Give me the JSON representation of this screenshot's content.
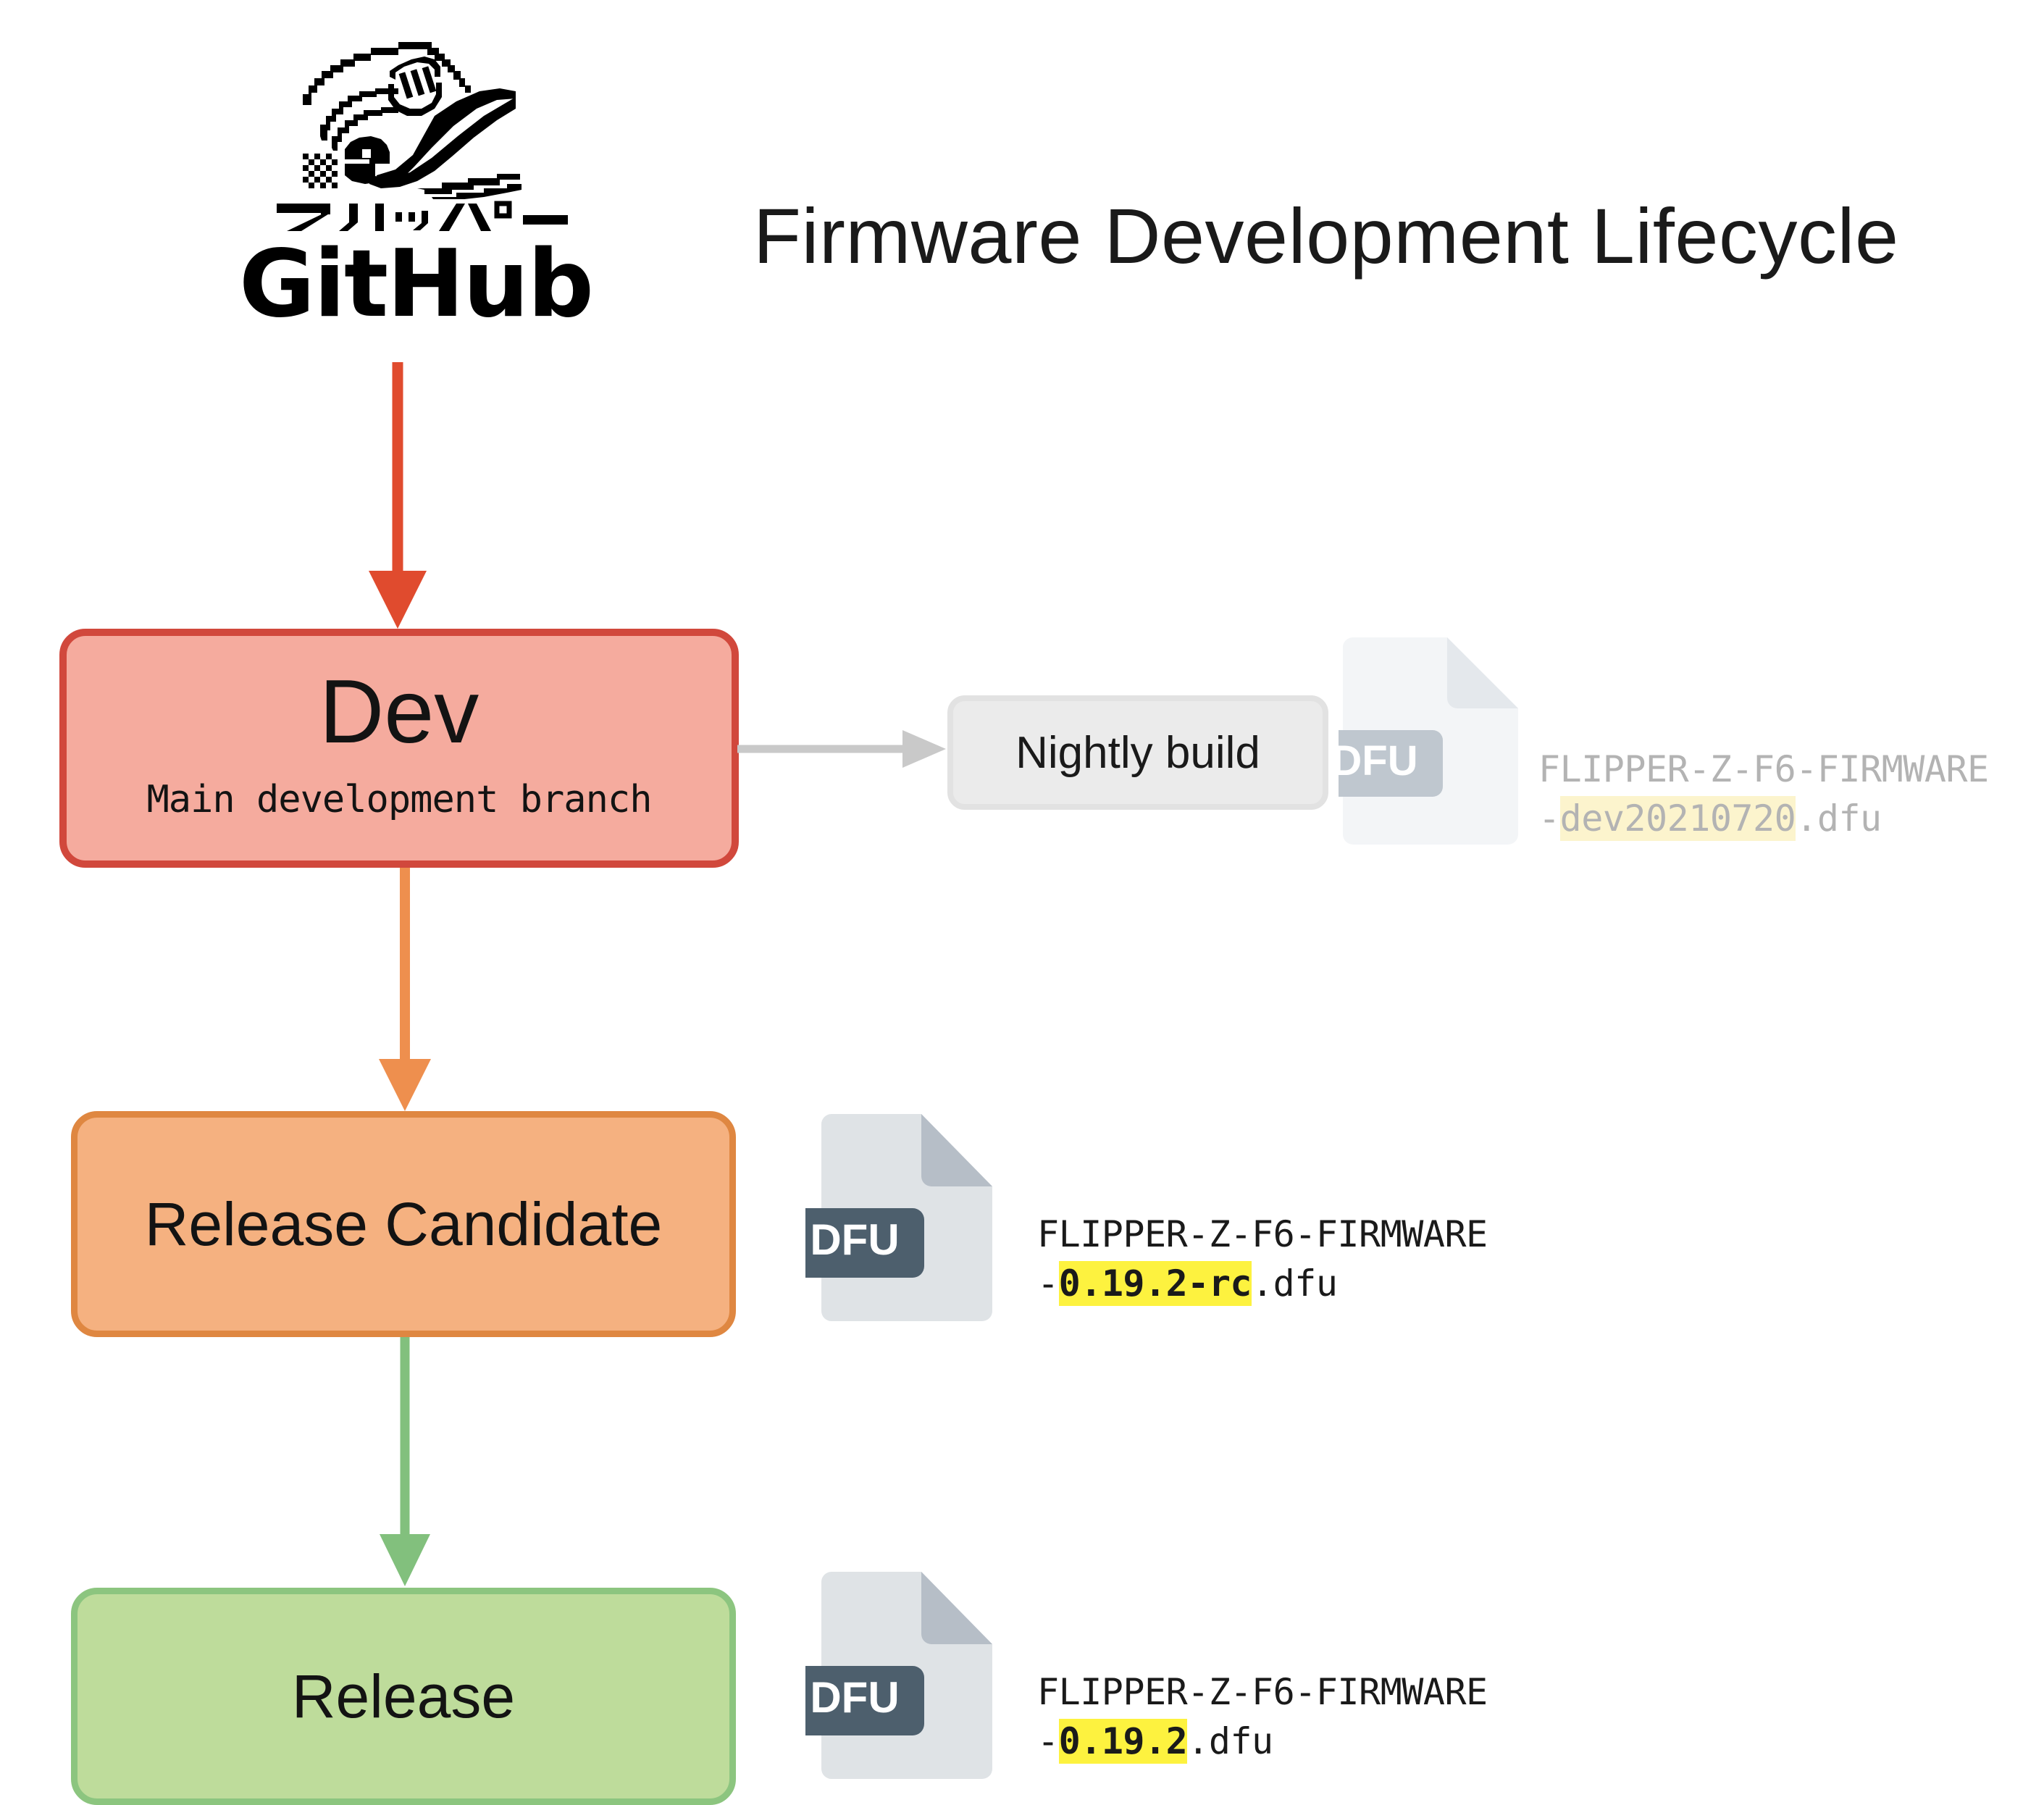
{
  "header": {
    "brand_wordmark": "GitHub",
    "logo_icon": "flipper-zero-dolphin-logo",
    "logo_katakana": "フリッパー",
    "title": "Firmware Development Lifecycle"
  },
  "stages": [
    {
      "id": "dev",
      "title": "Dev",
      "subtitle": "Main development branch",
      "fill": "#f5ab9e",
      "stroke": "#d1483c"
    },
    {
      "id": "release-candidate",
      "title": "Release Candidate",
      "subtitle": "",
      "fill": "#f5b180",
      "stroke": "#df8741"
    },
    {
      "id": "release",
      "title": "Release",
      "subtitle": "",
      "fill": "#bedc9b",
      "stroke": "#8cc57f"
    }
  ],
  "nightly": {
    "label": "Nightly build",
    "fill": "#ebebeb",
    "stroke": "#e2e2e2"
  },
  "arrows": [
    {
      "id": "github-to-dev",
      "color": "#e04b2e",
      "direction": "down"
    },
    {
      "id": "dev-to-nightly",
      "color": "#c9c9c9",
      "direction": "right"
    },
    {
      "id": "dev-to-rc",
      "color": "#ee8f4e",
      "direction": "down"
    },
    {
      "id": "rc-to-release",
      "color": "#82c07d",
      "direction": "down"
    }
  ],
  "artifacts": [
    {
      "id": "nightly-dfu",
      "icon_label": "DFU",
      "icon_name": "dfu-file-icon",
      "filename_line1": "FLIPPER-Z-F6-FIRMWARE",
      "filename_prefix": "-",
      "filename_version": "dev20210720",
      "filename_suffix": ".dfu",
      "faded": true,
      "highlight_color": "#fcf4cd",
      "page_color": "#f3f5f7",
      "badge_color": "#bfc7cf"
    },
    {
      "id": "rc-dfu",
      "icon_label": "DFU",
      "icon_name": "dfu-file-icon",
      "filename_line1": "FLIPPER-Z-F6-FIRMWARE",
      "filename_prefix": "-",
      "filename_version": "0.19.2-rc",
      "filename_suffix": ".dfu",
      "faded": false,
      "highlight_color": "#fdf23f",
      "page_color": "#dfe3e6",
      "badge_color": "#4d5f6d"
    },
    {
      "id": "release-dfu",
      "icon_label": "DFU",
      "icon_name": "dfu-file-icon",
      "filename_line1": "FLIPPER-Z-F6-FIRMWARE",
      "filename_prefix": "-",
      "filename_version": "0.19.2",
      "filename_suffix": ".dfu",
      "faded": false,
      "highlight_color": "#fdf23f",
      "page_color": "#dfe3e6",
      "badge_color": "#4d5f6d"
    }
  ]
}
